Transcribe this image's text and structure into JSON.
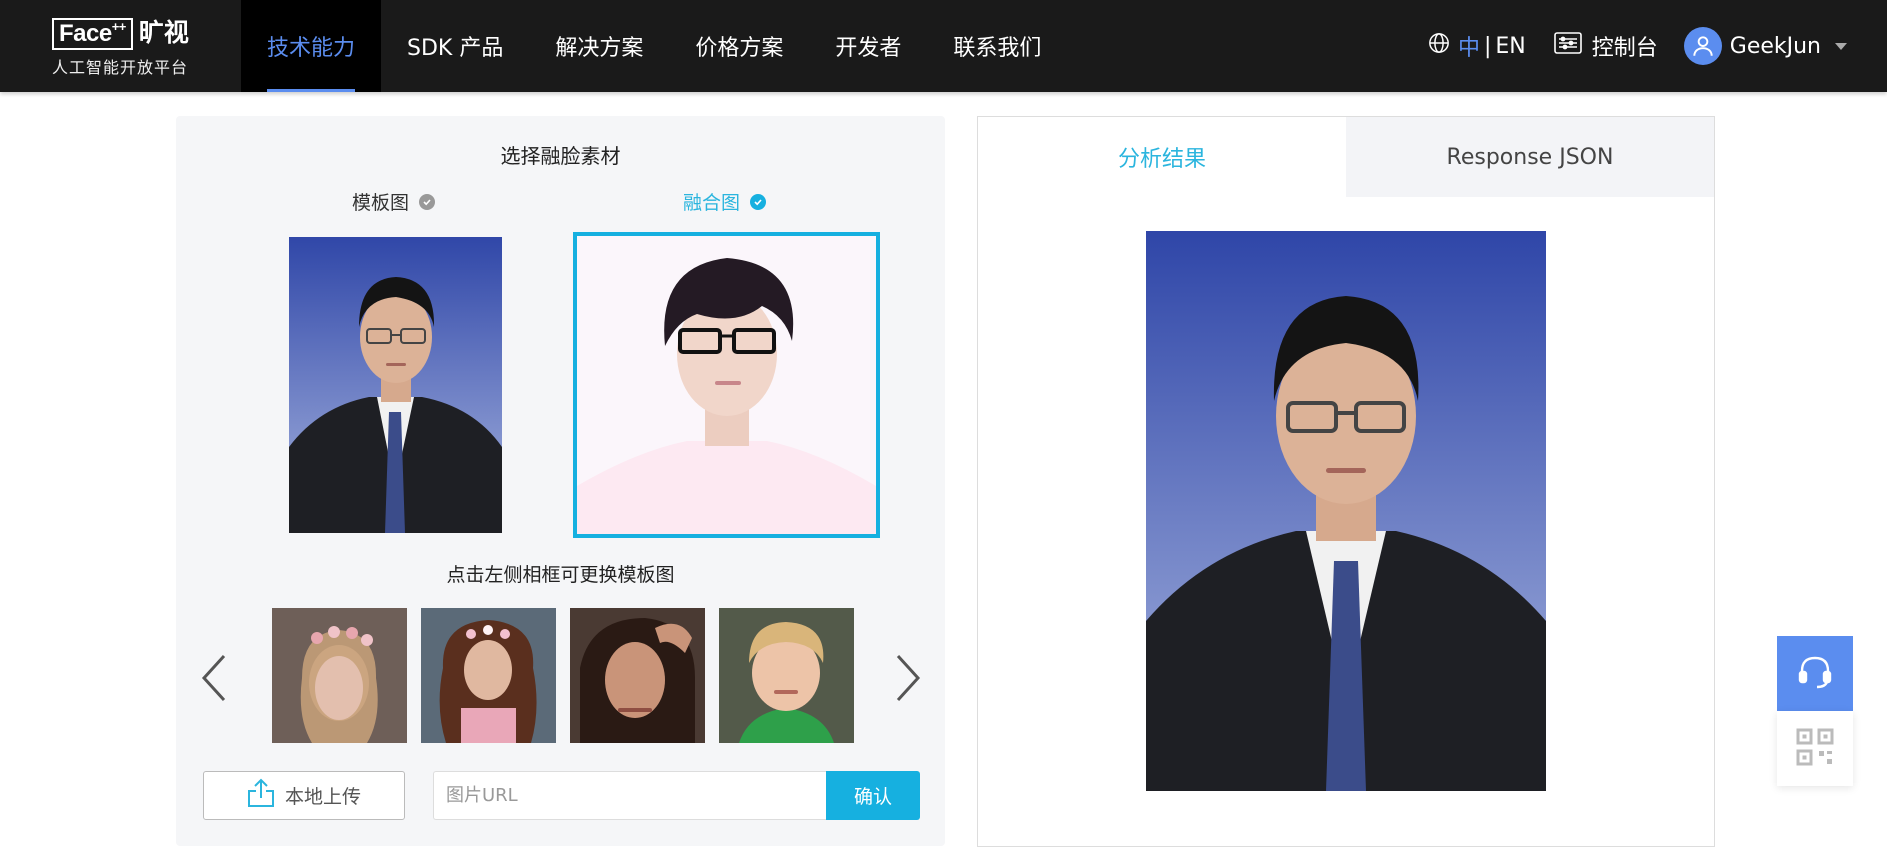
{
  "logo": {
    "brand": "Face",
    "brand_sup": "++",
    "brand_cn": "旷视",
    "subtitle": "人工智能开放平台"
  },
  "nav": {
    "items": [
      {
        "label": "技术能力",
        "active": true
      },
      {
        "label": "SDK 产品"
      },
      {
        "label": "解决方案"
      },
      {
        "label": "价格方案"
      },
      {
        "label": "开发者"
      },
      {
        "label": "联系我们"
      }
    ],
    "lang_zh": "中",
    "lang_sep": "|",
    "lang_en": "EN",
    "console": "控制台",
    "username": "GeekJun"
  },
  "left": {
    "title": "选择融脸素材",
    "template_label": "模板图",
    "fusion_label": "融合图",
    "hint": "点击左侧相框可更换模板图",
    "upload_label": "本地上传",
    "url_placeholder": "图片URL",
    "confirm_label": "确认"
  },
  "right": {
    "tab_result": "分析结果",
    "tab_json": "Response JSON"
  },
  "colors": {
    "accent_blue": "#16b0e0",
    "nav_active": "#5b8def",
    "nav_bg": "#1a1a1a"
  },
  "icons": [
    "globe-icon",
    "console-icon",
    "user-icon",
    "check-icon",
    "chevron-left-icon",
    "chevron-right-icon",
    "upload-icon",
    "headset-icon",
    "qr-code-icon"
  ]
}
